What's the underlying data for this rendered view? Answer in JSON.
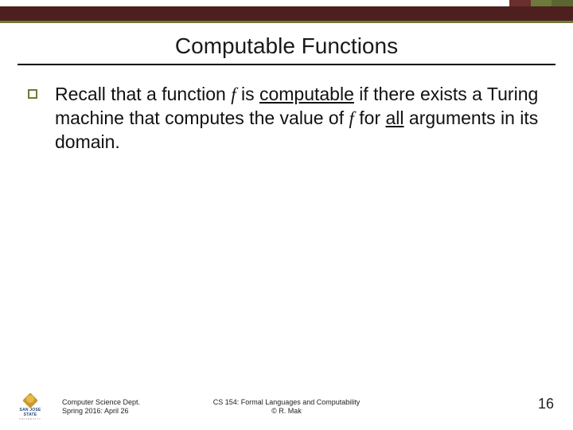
{
  "title": "Computable Functions",
  "body": {
    "pre1": "Recall that a function ",
    "fvar1": "f",
    "mid1": " is ",
    "computable": "computable",
    "mid2": " if there exists a Turing machine that computes the value of ",
    "fvar2": "f",
    "mid3": " for ",
    "all": "all",
    "post": " arguments in its domain."
  },
  "footer": {
    "dept": "Computer Science Dept.",
    "term": "Spring 2016: April 26",
    "course": "CS 154: Formal Languages and Computability",
    "copyright": "© R. Mak",
    "logo_name": "SAN JOSE STATE",
    "logo_sub": "UNIVERSITY"
  },
  "page_number": "16"
}
